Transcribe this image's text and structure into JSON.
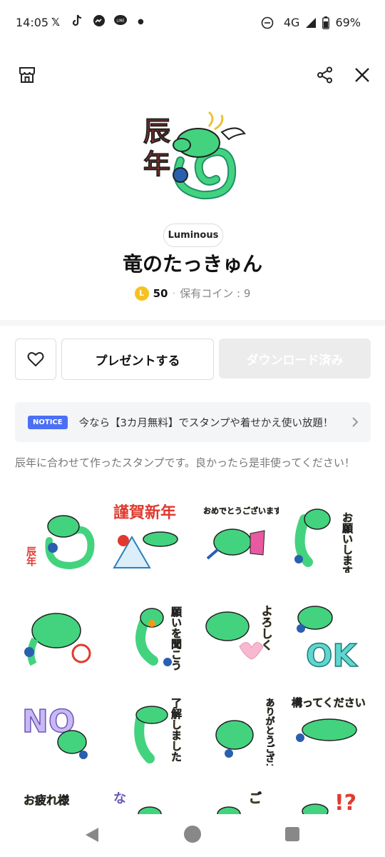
{
  "status_bar": {
    "time": "14:05",
    "network": "4G",
    "battery": "69%",
    "notif_icons": [
      "x-icon",
      "tiktok-icon",
      "messenger-icon",
      "line-icon",
      "dot-icon"
    ]
  },
  "header": {
    "store_icon": "store-icon",
    "share_icon": "share-icon",
    "close_icon": "close-icon"
  },
  "pack": {
    "author": "Luminous",
    "title": "竜のたっきゅん",
    "coin_letter": "L",
    "price": "50",
    "owned_coins": "保有コイン : 9",
    "description": "辰年に合わせて作ったスタンプです。良かったら是非使ってください！"
  },
  "hero_text": [
    "辰",
    "年"
  ],
  "actions": {
    "favorite_icon": "heart-icon",
    "gift_label": "プレゼントする",
    "download_label": "ダウンロード済み"
  },
  "notice": {
    "badge": "NOTICE",
    "text": "今なら【3カ月無料】でスタンプや着せかえ使い放題！"
  },
  "stickers": [
    {
      "text": "辰年"
    },
    {
      "text": "謹賀新年"
    },
    {
      "text": "おめでとうございます"
    },
    {
      "text": "お願いします"
    },
    {
      "text": ""
    },
    {
      "text": "願いを聞こう"
    },
    {
      "text": "よろしく"
    },
    {
      "text": "OK"
    },
    {
      "text": "NO"
    },
    {
      "text": "了解しました"
    },
    {
      "text": "ありがとうございます"
    },
    {
      "text": "構ってください"
    },
    {
      "text": "お疲れ様"
    },
    {
      "text": "な"
    },
    {
      "text": "ご"
    },
    {
      "text": "!?"
    }
  ],
  "colors": {
    "dragon_green": "#43d37f",
    "dragon_dark": "#1f8f6a",
    "accent_red": "#e03a2f",
    "notice_blue": "#4b6ff5",
    "coin_yellow": "#f7c21d"
  }
}
